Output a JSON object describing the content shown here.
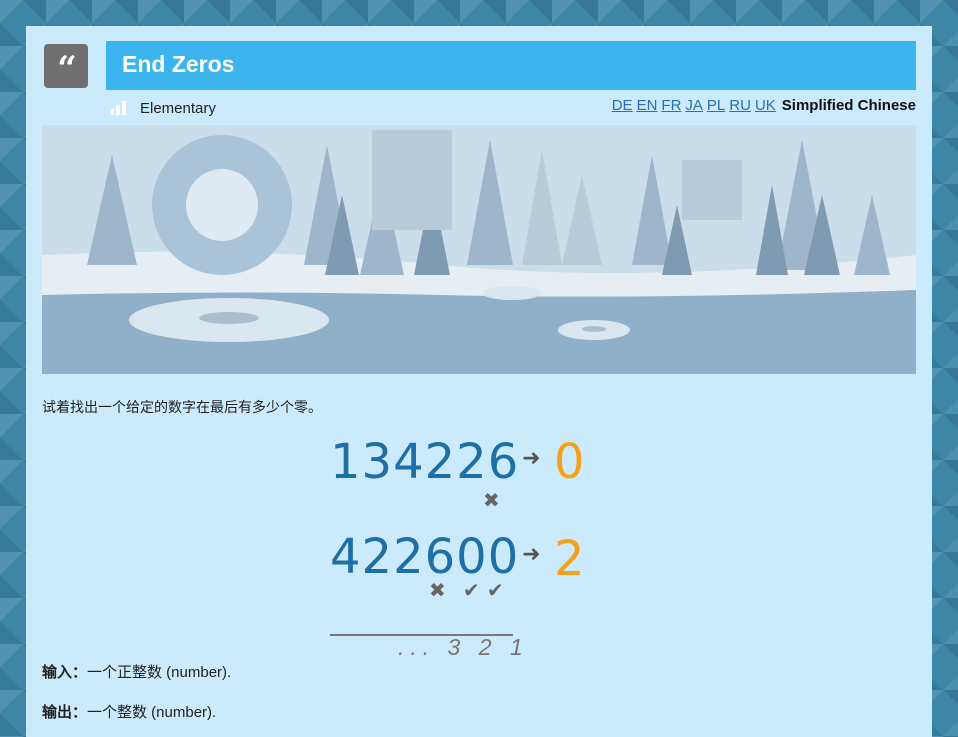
{
  "task": {
    "title": "End Zeros",
    "difficulty": "Elementary"
  },
  "languages": [
    "DE",
    "EN",
    "FR",
    "JA",
    "PL",
    "RU",
    "UK"
  ],
  "current_language": "Simplified Chinese",
  "description": "试着找出一个给定的数字在最后有多少个零。",
  "example": {
    "rows": [
      {
        "number": "134226",
        "result": "0",
        "marks": [
          "✖"
        ]
      },
      {
        "number": "422600",
        "result": "2",
        "marks": [
          "✖",
          "✔",
          "✔"
        ]
      }
    ],
    "counter": "... 3 2 1"
  },
  "io": {
    "input_label": "输入：",
    "input_text": "一个正整数 (number).",
    "output_label": "输出：",
    "output_text": "一个整数 (number)."
  },
  "colors": {
    "title_bar": "#3cb5ef",
    "panel": "#cbeafb",
    "number": "#1d6fa5",
    "result": "#f5a11b"
  },
  "icons": {
    "quote": "quote-icon",
    "difficulty": "signal-bars-icon"
  }
}
